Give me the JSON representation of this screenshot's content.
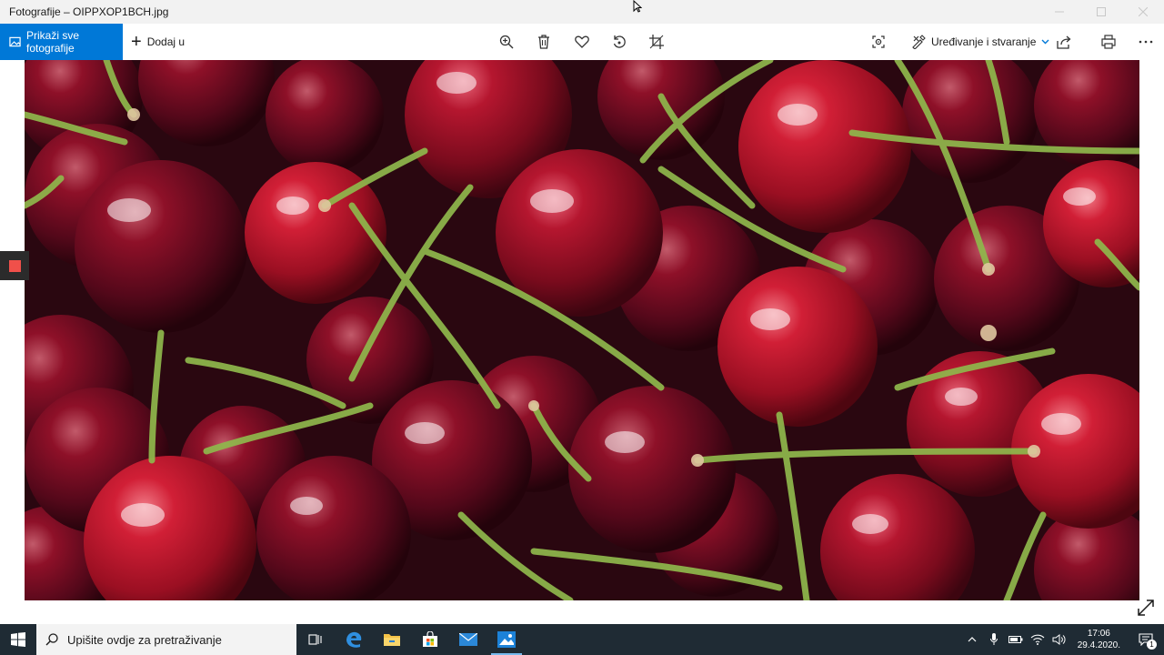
{
  "window": {
    "title": "Fotografije – OIPPXOP1BCH.jpg"
  },
  "toolbar": {
    "show_all_label": "Prikaži sve fotografije",
    "add_to_label": "Dodaj u",
    "edit_create_label": "Uređivanje i stvaranje",
    "icons": [
      "zoom-icon",
      "delete-icon",
      "favorite-icon",
      "rotate-icon",
      "crop-icon",
      "enhance-icon",
      "share-icon",
      "print-icon",
      "more-icon"
    ]
  },
  "taskbar": {
    "search_placeholder": "Upišite ovdje za pretraživanje",
    "apps": [
      "task-view-icon",
      "edge-icon",
      "file-explorer-icon",
      "store-icon",
      "mail-icon",
      "photos-icon"
    ],
    "time": "17:06",
    "date": "29.4.2020.",
    "notification_count": "1"
  },
  "colors": {
    "accent": "#0078d7",
    "taskbar": "#1f2b34",
    "cherry_red": "#b0122a",
    "stem_green": "#8fb84c"
  }
}
